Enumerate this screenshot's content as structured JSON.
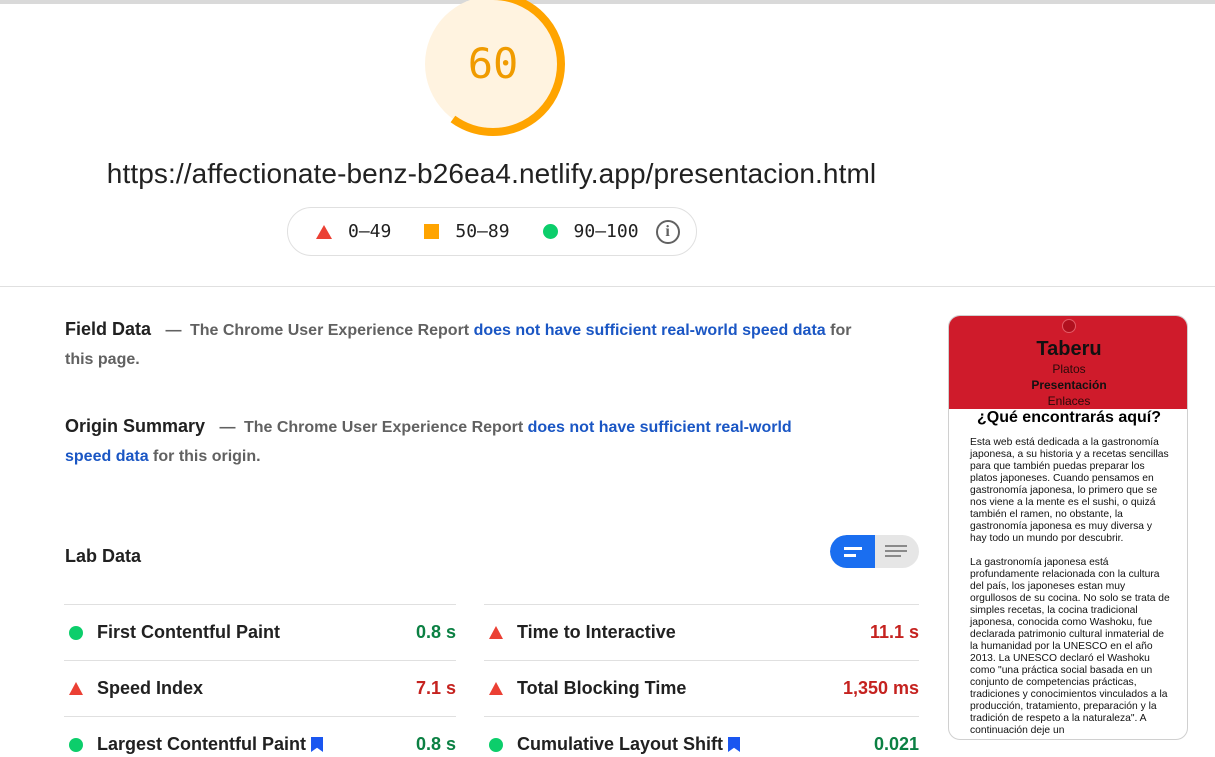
{
  "score": {
    "value": "60",
    "fraction": 0.6,
    "color": "#ffa400"
  },
  "url": "https://affectionate-benz-b26ea4.netlify.app/presentacion.html",
  "legend": {
    "poor": "0–49",
    "average": "50–89",
    "good": "90–100",
    "info_icon": "info-icon"
  },
  "field_data": {
    "heading": "Field Data",
    "dash": "—",
    "prefix": "The Chrome User Experience Report",
    "link": "does not have sufficient real-world speed data",
    "suffix": "for this page."
  },
  "origin_summary": {
    "heading": "Origin Summary",
    "dash": "—",
    "prefix": "The Chrome User Experience Report",
    "link": "does not have sufficient real-world speed data",
    "suffix": "for this origin."
  },
  "lab_data": {
    "heading": "Lab Data",
    "metrics_left": [
      {
        "label": "First Contentful Paint",
        "value": "0.8 s",
        "rating": "good"
      },
      {
        "label": "Speed Index",
        "value": "7.1 s",
        "rating": "poor"
      },
      {
        "label": "Largest Contentful Paint",
        "value": "0.8 s",
        "rating": "good"
      }
    ],
    "metrics_right": [
      {
        "label": "Time to Interactive",
        "value": "11.1 s",
        "rating": "poor"
      },
      {
        "label": "Total Blocking Time",
        "value": "1,350 ms",
        "rating": "poor"
      },
      {
        "label": "Cumulative Layout Shift",
        "value": "0.021",
        "rating": "good"
      }
    ]
  },
  "colors": {
    "good": "#0cce6b",
    "average": "#ffa400",
    "poor": "#eb4034",
    "link": "#1a56c4"
  },
  "thumbnail": {
    "title": "Taberu",
    "nav": [
      "Platos",
      "Presentación",
      "Enlaces"
    ],
    "heading": "¿Qué encontrarás aquí?",
    "paragraph1": "Esta web está dedicada a la gastronomía japonesa, a su historia y a recetas sencillas para que también puedas preparar los platos japoneses. Cuando pensamos en gastronomía japonesa, lo primero que se nos viene a la mente es el sushi, o quizá también el ramen, no obstante, la gastronomía japonesa es muy diversa y hay todo un mundo por descubrir.",
    "paragraph2": "La gastronomía japonesa está profundamente relacionada con la cultura del país, los japoneses estan muy orgullosos de su cocina. No solo se trata de simples recetas, la cocina tradicional japonesa, conocida como Washoku, fue declarada patrimonio cultural inmaterial de la humanidad por la UNESCO en el año 2013. La UNESCO declaró el Washoku como \"una práctica social basada en un conjunto de competencias prácticas, tradiciones y conocimientos vinculados a la producción, tratamiento, preparación y la tradición de respeto a la naturaleza\". A continuación deje un"
  }
}
